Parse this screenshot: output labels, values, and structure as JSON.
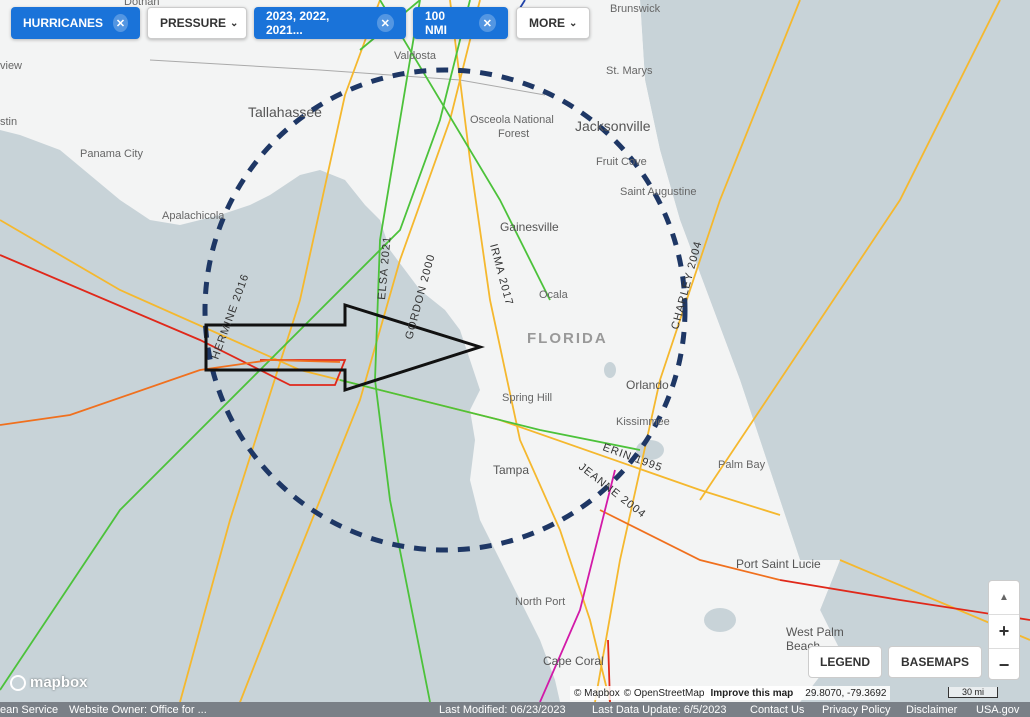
{
  "filters": {
    "hurricanes_label": "HURRICANES",
    "pressure_label": "PRESSURE",
    "years_label": "2023, 2022, 2021...",
    "radius_label": "100 NMI",
    "more_label": "MORE",
    "remove_symbol": "✕",
    "caret_symbol": "⌄"
  },
  "map_labels": {
    "valdosta": "Valdosta",
    "tallahassee": "Tallahassee",
    "panama_city": "Panama City",
    "apalachicola": "Apalachicola",
    "jacksonville": "Jacksonville",
    "st_marys": "St. Marys",
    "brunswick": "Brunswick",
    "osceola": "Osceola National",
    "osceola2": "Forest",
    "fruit_cove": "Fruit Cove",
    "st_augustine": "Saint Augustine",
    "gainesville": "Gainesville",
    "ocala": "Ocala",
    "florida": "FLORIDA",
    "orlando": "Orlando",
    "kissimmee": "Kissimmee",
    "spring_hill": "Spring Hill",
    "tampa": "Tampa",
    "palm_bay": "Palm Bay",
    "port_saint_lucie": "Port Saint Lucie",
    "north_port": "North Port",
    "cape_coral": "Cape Coral",
    "west_palm": "West Palm",
    "west_palm2": "Beach",
    "dothan": "Dothan",
    "view": "view",
    "austin": "stin"
  },
  "storm_labels": {
    "hermine": "HERMINE 2016",
    "elsa": "ELSA 2021",
    "gordon": "GORDON 2000",
    "irma": "IRMA 2017",
    "charley": "CHARLEY 2004",
    "erin": "ERIN 1995",
    "jeanne": "JEANNE 2004"
  },
  "controls": {
    "legend": "LEGEND",
    "basemaps": "BASEMAPS",
    "zoom_in": "+",
    "zoom_out": "−",
    "compass": "▲"
  },
  "attribution": {
    "mapbox": "© Mapbox",
    "osm": "© OpenStreetMap",
    "improve": "Improve this map",
    "coords": "29.8070, -79.3692",
    "scale": "30 mi"
  },
  "logo": "mapbox",
  "footer": {
    "ocean_service": "ean Service",
    "owner": "Website Owner: Office for ...",
    "modified": "Last Modified: 06/23/2023",
    "data_update": "Last Data Update: 6/5/2023",
    "contact": "Contact Us",
    "privacy": "Privacy Policy",
    "disclaimer": "Disclaimer",
    "usagov": "USA.gov"
  },
  "colors": {
    "water": "#c8d3d8",
    "land": "#f3f4f4",
    "filter_blue": "#1a73d9",
    "circle": "#1e3765",
    "track_yellow": "#f5b82e",
    "track_green": "#4cc23a",
    "track_red": "#e0281a",
    "track_orange": "#f0701e",
    "track_magenta": "#d21aa8"
  }
}
